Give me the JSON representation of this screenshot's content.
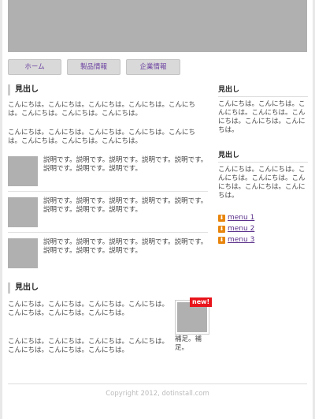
{
  "nav": [
    "ホーム",
    "製品情報",
    "企業情報"
  ],
  "main": {
    "section1": {
      "heading": "見出し",
      "paragraphs": [
        "こんにちは。こんにちは。こんにちは。こんにちは。こんにちは。こんにちは。こんにちは。こんにちは。",
        "こんにちは。こんにちは。こんにちは。こんにちは。こんにちは。こんにちは。こんにちは。こんにちは。"
      ],
      "items": [
        "説明です。説明です。説明です。説明です。説明です。説明です。説明です。説明です。",
        "説明です。説明です。説明です。説明です。説明です。説明です。説明です。説明です。",
        "説明です。説明です。説明です。説明です。説明です。説明です。説明です。説明です。"
      ]
    },
    "section2": {
      "heading": "見出し",
      "paragraphs": [
        "こんにちは。こんにちは。こんにちは。こんにちは。こんにちは。こんにちは。こんにちは。",
        "こんにちは。こんにちは。こんにちは。こんにちは。こんにちは。こんにちは。こんにちは。"
      ],
      "figure_badge": "new!",
      "figure_caption": "補足。補足。"
    }
  },
  "sidebar": {
    "sections": [
      {
        "heading": "見出し",
        "text": "こんにちは。こんにちは。こんにちは。こんにちは。こんにちは。こんにちは。こんにちは。"
      },
      {
        "heading": "見出し",
        "text": "こんにちは。こんにちは。こんにちは。こんにちは。こんにちは。こんにちは。こんにちは。"
      }
    ],
    "menu": [
      "menu 1",
      "menu 2",
      "menu 3"
    ],
    "menu_icon": "orange-arrow-icon"
  },
  "footer": "Copyright 2012, dotinstall.com",
  "colors": {
    "banner": "#b0b0b0",
    "nav_text": "#6a3fa0",
    "menu_icon": "#e8850c",
    "badge": "#e8141b"
  }
}
